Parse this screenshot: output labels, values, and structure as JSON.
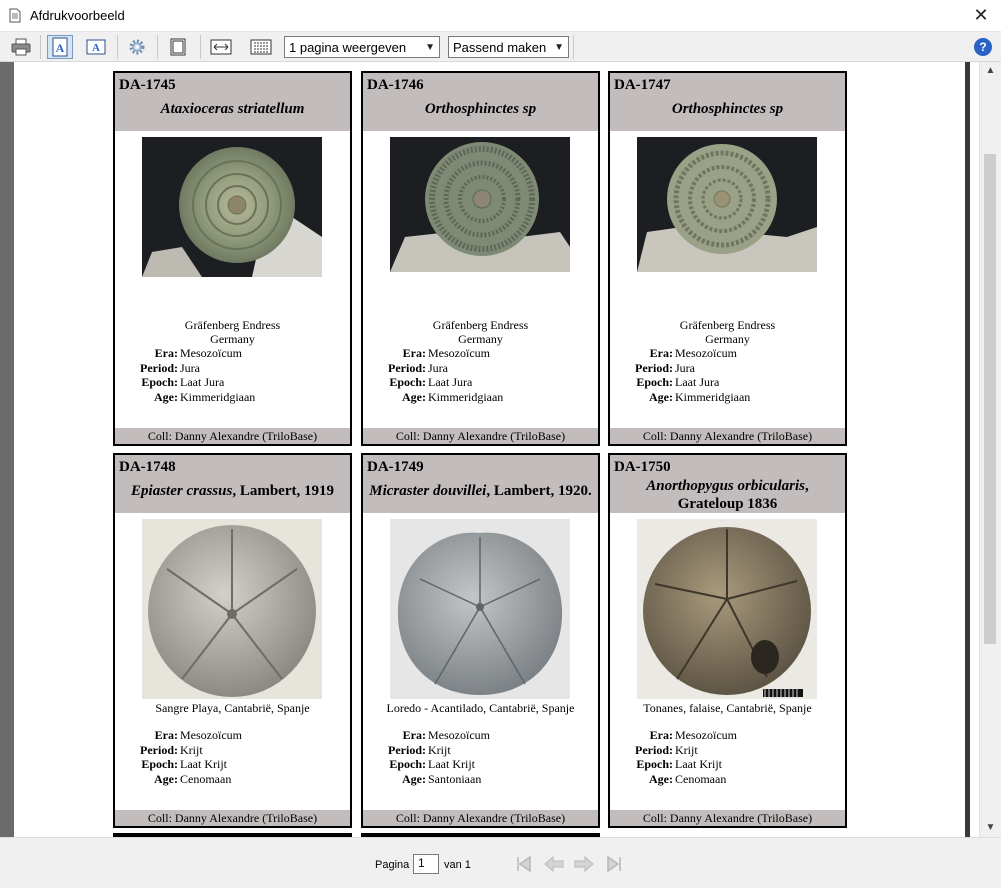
{
  "window": {
    "title": "Afdrukvoorbeeld"
  },
  "toolbar": {
    "pages_select": "1 pagina weergeven",
    "zoom_select": "Passend maken"
  },
  "cards": [
    {
      "code": "DA-1745",
      "name_italic": "Ataxioceras striatellum",
      "name_suffix": "",
      "loc1": "Gräfenberg Endress",
      "loc2": "Germany",
      "era": "Mesozoïcum",
      "period": "Jura",
      "epoch": "Laat Jura",
      "age": "Kimmeridgiaan",
      "coll": "Coll: Danny Alexandre (TriloBase)"
    },
    {
      "code": "DA-1746",
      "name_italic": "Orthosphinctes sp",
      "name_suffix": "",
      "loc1": "Gräfenberg Endress",
      "loc2": "Germany",
      "era": "Mesozoïcum",
      "period": "Jura",
      "epoch": "Laat Jura",
      "age": "Kimmeridgiaan",
      "coll": "Coll: Danny Alexandre (TriloBase)"
    },
    {
      "code": "DA-1747",
      "name_italic": "Orthosphinctes sp",
      "name_suffix": "",
      "loc1": "Gräfenberg Endress",
      "loc2": "Germany",
      "era": "Mesozoïcum",
      "period": "Jura",
      "epoch": "Laat Jura",
      "age": "Kimmeridgiaan",
      "coll": "Coll: Danny Alexandre (TriloBase)"
    },
    {
      "code": "DA-1748",
      "name_italic": "Epiaster crassus",
      "name_suffix": ", Lambert, 1919",
      "loc1": "Sangre Playa, Cantabrië, Spanje",
      "loc2": "",
      "era": "Mesozoïcum",
      "period": "Krijt",
      "epoch": "Laat Krijt",
      "age": "Cenomaan",
      "coll": "Coll: Danny Alexandre (TriloBase)"
    },
    {
      "code": "DA-1749",
      "name_italic": "Micraster douvillei",
      "name_suffix": ", Lambert, 1920.",
      "loc1": "Loredo - Acantilado, Cantabrië, Spanje",
      "loc2": "",
      "era": "Mesozoïcum",
      "period": "Krijt",
      "epoch": "Laat Krijt",
      "age": "Santoniaan",
      "coll": "Coll: Danny Alexandre (TriloBase)"
    },
    {
      "code": "DA-1750",
      "name_italic": "Anorthopygus orbicularis",
      "name_suffix": ", Grateloup 1836",
      "loc1": "Tonanes, falaise, Cantabrië, Spanje",
      "loc2": "",
      "era": "Mesozoïcum",
      "period": "Krijt",
      "epoch": "Laat Krijt",
      "age": "Cenomaan",
      "coll": "Coll: Danny Alexandre (TriloBase)"
    }
  ],
  "labels": {
    "era": "Era:",
    "period": "Period:",
    "epoch": "Epoch:",
    "age": "Age:"
  },
  "status": {
    "page_label": "Pagina",
    "page_value": "1",
    "of_label": "van 1"
  }
}
